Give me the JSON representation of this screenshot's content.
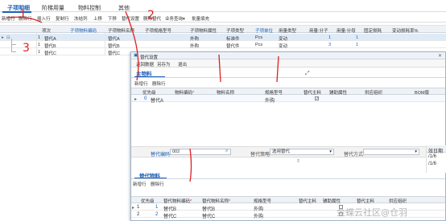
{
  "tabs": [
    "子项明细",
    "阶梯用量",
    "物料控制",
    "其他"
  ],
  "toolbar": [
    "新增行",
    "删除行",
    "插入行",
    "复制行",
    "冻结列",
    "上移",
    "下移",
    "替代设置",
    "删除替代",
    "业务查询",
    "批量填充"
  ],
  "toolbar_dropdowns": [
    "业务查询"
  ],
  "grid_headers": [
    "项次",
    "子项物料编码",
    "子项物料名称",
    "子项规格型号",
    "子项物料属性",
    "子项类型",
    "子项单位",
    "用量类型",
    "用量:分子",
    "用量:分母",
    "固定损耗",
    "变动损耗率%"
  ],
  "grid_header_links": [
    "子项物料编码",
    "子项单位"
  ],
  "rows": [
    {
      "idx": "1",
      "code": "替代A",
      "name": "替代A",
      "attr": "外购",
      "type": "标准件",
      "unit": "Pcs",
      "usage": "变动",
      "num": "1",
      "den": "1"
    },
    {
      "idx": "1",
      "code": "替代B",
      "name": "替代B",
      "attr": "外购",
      "type": "替代件",
      "unit": "Pcs",
      "usage": "变动",
      "num": "3",
      "den": "1"
    },
    {
      "idx": "1",
      "code": "替代C",
      "name": "替代C",
      "attr": "外购",
      "type": "替代件",
      "unit": "Pcs",
      "usage": "变动",
      "num": "2",
      "den": "1"
    }
  ],
  "dialog": {
    "title": "替代设置",
    "toolbar": [
      "返回数据",
      "另存为",
      "退出"
    ],
    "section1": "主物料",
    "section1_toolbar": [
      "新增行",
      "删除行"
    ],
    "main_headers": [
      "优先级",
      "物料编码",
      "物料名称",
      "规格型号",
      "替代主料",
      "辅助属性",
      "供应组织",
      "BOM版"
    ],
    "main_header_marks": [
      "物料编码"
    ],
    "main_rows": [
      {
        "priority": "0",
        "code": "替代A",
        "attr": "外购"
      }
    ],
    "form": {
      "label_code": "替代编码",
      "code_value": "002",
      "label_strategy": "替代策略",
      "strategy_value": "选用替代",
      "label_method": "替代方式",
      "method_value": ""
    },
    "section2": "替代物料",
    "section2_toolbar": [
      "新增行",
      "删除行"
    ],
    "sub_headers": [
      "优先级",
      "替代物料编码",
      "替代物料名称",
      "规格型号",
      "替代主料",
      "辅助属性",
      "替代主料",
      "供应组织"
    ],
    "sub_header_marks": [
      "替代物料编码",
      "替代物料名称"
    ],
    "sub_rows": [
      {
        "no": "1",
        "priority": "1",
        "code": "替代B",
        "name": "替代B",
        "attr": "外购"
      },
      {
        "no": "2",
        "priority": "2",
        "code": "替代C",
        "name": "替代C",
        "attr": "外购"
      }
    ],
    "right_col_header": "效日期",
    "right_col_values": [
      "/1/6",
      "/1/6"
    ]
  },
  "annotations": [
    "1",
    "2",
    "3"
  ],
  "watermark": "金蝶云社区@仓羽"
}
